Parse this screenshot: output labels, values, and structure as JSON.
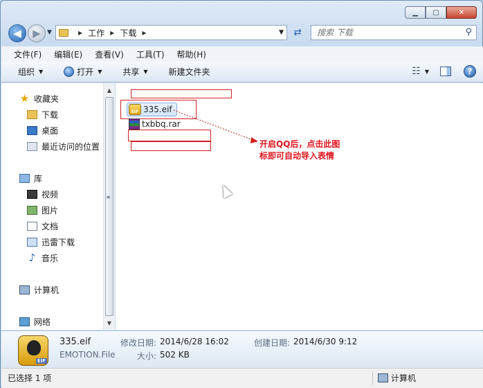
{
  "window": {
    "minimize": "▁",
    "maximize": "▢",
    "close": "✕"
  },
  "address": {
    "crumbs": [
      "工作",
      "下载"
    ]
  },
  "search": {
    "placeholder": "搜索 下载",
    "icon": "search-icon"
  },
  "menu": [
    "文件(F)",
    "编辑(E)",
    "查看(V)",
    "工具(T)",
    "帮助(H)"
  ],
  "toolbar": {
    "organize": "组织",
    "open": "打开",
    "share": "共享",
    "new_folder": "新建文件夹"
  },
  "sidebar": {
    "favorites": "收藏夹",
    "downloads": "下载",
    "desktop": "桌面",
    "recent": "最近访问的位置",
    "libraries": "库",
    "videos": "视频",
    "pictures": "图片",
    "documents": "文档",
    "thunder": "迅雷下载",
    "music": "音乐",
    "computer": "计算机",
    "network": "网络"
  },
  "files": [
    {
      "name": "335.eif",
      "type": "eif",
      "selected": true
    },
    {
      "name": "txbbq.rar",
      "type": "rar",
      "selected": false
    }
  ],
  "annotation": {
    "line1": "开启QQ后，点击此图",
    "line2": "标即可自动导入表情",
    "color": "#e0141e"
  },
  "details": {
    "filename": "335.eif",
    "filetype": "EMOTION.File",
    "modified_label": "修改日期:",
    "modified_value": "2014/6/28 16:02",
    "created_label": "创建日期:",
    "created_value": "2014/6/30 9:12",
    "size_label": "大小:",
    "size_value": "502 KB",
    "icon_tag": "EIF"
  },
  "status": {
    "left": "已选择 1 项",
    "right": "计算机"
  }
}
